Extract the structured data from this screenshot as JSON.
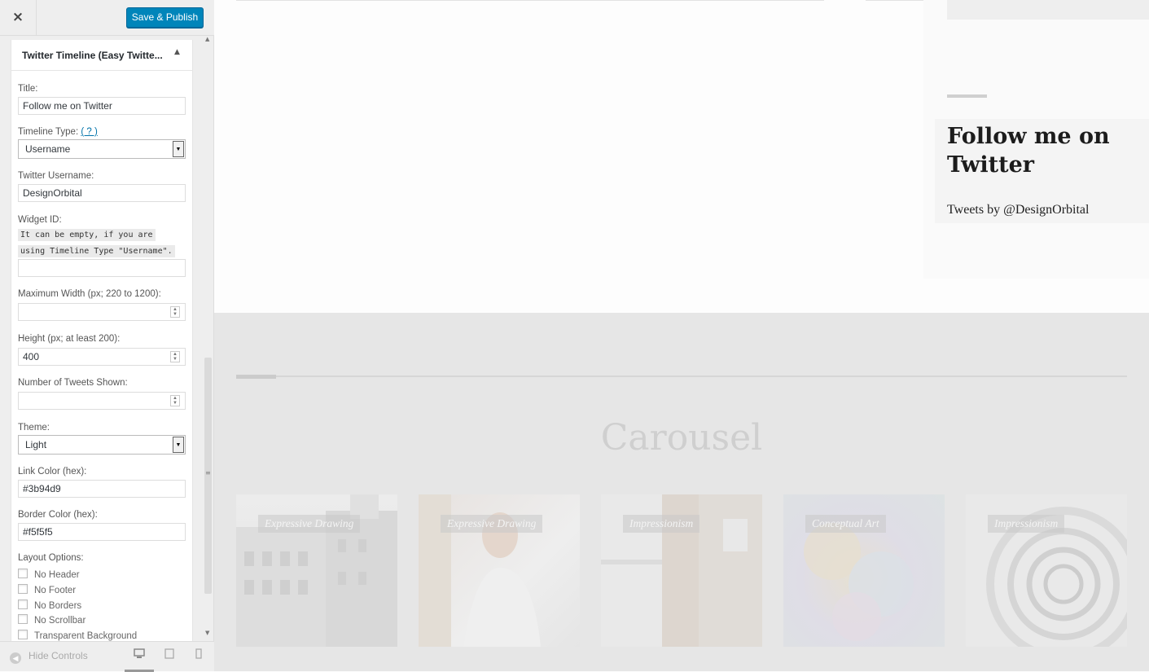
{
  "sidebar": {
    "close_icon": "×",
    "save_label": "Save & Publish",
    "widget_title": "Twitter Timeline (Easy Twitte...",
    "title_label": "Title:",
    "title_value": "Follow me on Twitter",
    "timeline_type_label": "Timeline Type:",
    "timeline_type_help": "( ? )",
    "timeline_type_value": "Username",
    "username_label": "Twitter Username:",
    "username_value": "DesignOrbital",
    "widget_id_label": "Widget ID:",
    "widget_id_note_1": "It can be empty, if you are",
    "widget_id_note_2": "using Timeline Type \"Username\".",
    "widget_id_value": "",
    "max_width_label": "Maximum Width (px; 220 to 1200):",
    "max_width_value": "",
    "height_label": "Height (px; at least 200):",
    "height_value": "400",
    "tweets_shown_label": "Number of Tweets Shown:",
    "tweets_shown_value": "",
    "theme_label": "Theme:",
    "theme_value": "Light",
    "link_color_label": "Link Color (hex):",
    "link_color_value": "#3b94d9",
    "border_color_label": "Border Color (hex):",
    "border_color_value": "#f5f5f5",
    "layout_options_label": "Layout Options:",
    "layout_options": [
      "No Header",
      "No Footer",
      "No Borders",
      "No Scrollbar",
      "Transparent Background"
    ],
    "hide_controls_label": "Hide Controls"
  },
  "preview": {
    "widget_heading": "Follow me on Twitter",
    "tweets_by": "Tweets by @DesignOrbital",
    "carousel_title": "Carousel",
    "carousel_items": [
      "Expressive Drawing",
      "Expressive Drawing",
      "Impressionism",
      "Conceptual Art",
      "Impressionism"
    ]
  },
  "colors": {
    "accent": "#0085ba",
    "link": "#0073aa"
  }
}
